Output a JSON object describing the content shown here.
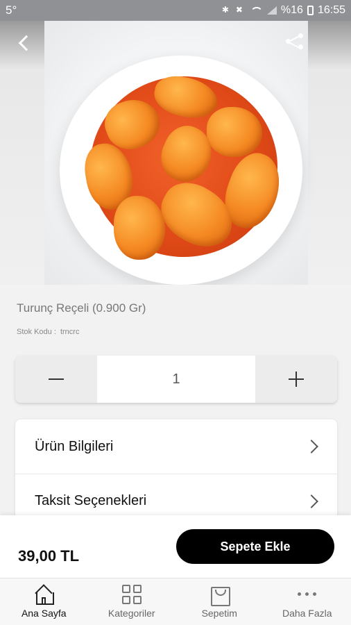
{
  "status_bar": {
    "left_text": "5°",
    "battery_text": "%16",
    "time": "16:55"
  },
  "product": {
    "title": "Turunç Reçeli (0.900 Gr)",
    "stock_label": "Stok Kodu :",
    "stock_code": "trncrc"
  },
  "quantity": {
    "value": "1"
  },
  "info_list": {
    "items": [
      {
        "label": "Ürün Bilgileri"
      },
      {
        "label": "Taksit Seçenekleri"
      }
    ]
  },
  "buy_bar": {
    "price": "39,00 TL",
    "add_to_cart_label": "Sepete Ekle"
  },
  "bottom_nav": {
    "items": [
      {
        "label": "Ana Sayfa",
        "icon": "home-icon"
      },
      {
        "label": "Kategoriler",
        "icon": "grid-icon"
      },
      {
        "label": "Sepetim",
        "icon": "bag-icon"
      },
      {
        "label": "Daha Fazla",
        "icon": "dots-icon"
      }
    ]
  },
  "colors": {
    "primary_button": "#000000",
    "status_bar": "#8f9194",
    "syrup": "#e04a18",
    "peel": "#f58a23"
  }
}
